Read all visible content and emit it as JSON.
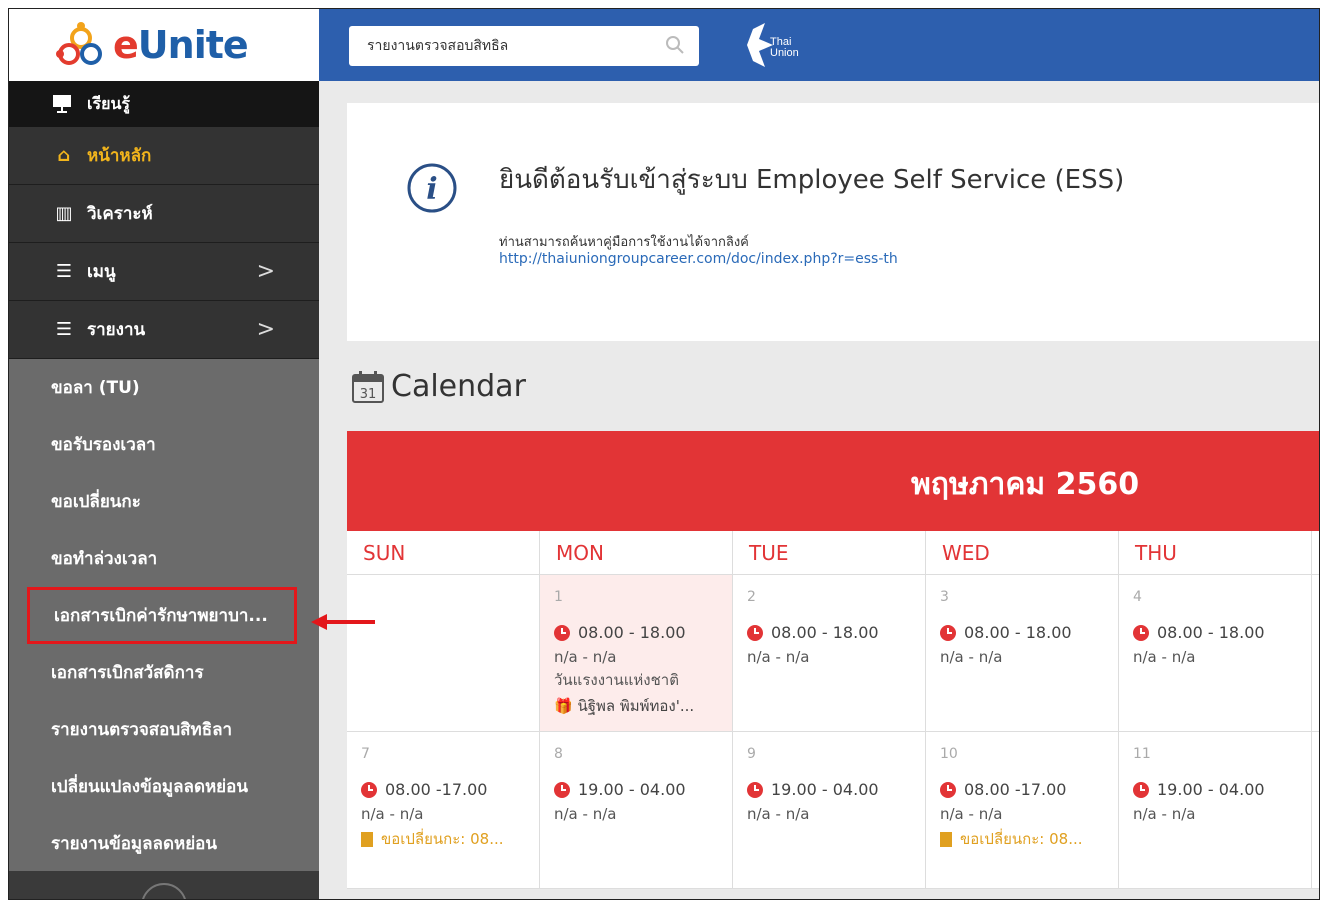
{
  "brand": {
    "logo_text_e": "e",
    "logo_text_rest": "Unite"
  },
  "sidebar": {
    "learn_label": "เรียนรู้",
    "main_items": [
      {
        "label": "หน้าหลัก",
        "icon": "home-icon"
      },
      {
        "label": "วิเคราะห์",
        "icon": "analytics-icon"
      },
      {
        "label": "เมนู",
        "icon": "list-icon",
        "chevron": ">"
      },
      {
        "label": "รายงาน",
        "icon": "list-icon",
        "chevron": ">"
      }
    ],
    "sub_items": [
      "ขอลา (TU)",
      "ขอรับรองเวลา",
      "ขอเปลี่ยนกะ",
      "ขอทำล่วงเวลา",
      "เอกสารเบิกค่ารักษาพยาบา...",
      "เอกสารเบิกสวัสดิการ",
      "รายงานตรวจสอบสิทธิลา",
      "เปลี่ยนแปลงข้อมูลลดหย่อน",
      "รายงานข้อมูลลดหย่อน"
    ]
  },
  "topbar": {
    "search_value": "รายงานตรวจสอบสิทธิล",
    "partner_logo_line1": "Thai",
    "partner_logo_line2": "Union"
  },
  "welcome": {
    "title": "ยินดีต้อนรับเข้าสู่ระบบ Employee Self Service (ESS)",
    "desc": "ท่านสามารถค้นหาคู่มือการใช้งานได้จากลิงค์",
    "link": "http://thaiuniongroupcareer.com/doc/index.php?r=ess-th"
  },
  "calendar": {
    "heading": "Calendar",
    "icon_day": "31",
    "month_label": "พฤษภาคม 2560",
    "weekdays": [
      "SUN",
      "MON",
      "TUE",
      "WED",
      "THU"
    ],
    "rows": [
      [
        {
          "day": "",
          "time": "",
          "na": ""
        },
        {
          "day": "1",
          "time": "08.00 - 18.00",
          "na": "n/a - n/a",
          "holiday": "วันแรงงานแห่งชาติ",
          "person": "นิฐิพล พิมพ์ทอง'..."
        },
        {
          "day": "2",
          "time": "08.00 - 18.00",
          "na": "n/a - n/a"
        },
        {
          "day": "3",
          "time": "08.00 - 18.00",
          "na": "n/a - n/a"
        },
        {
          "day": "4",
          "time": "08.00 - 18.00",
          "na": "n/a - n/a"
        }
      ],
      [
        {
          "day": "7",
          "time": "08.00 -17.00",
          "na": "n/a - n/a",
          "shift": "ขอเปลี่ยนกะ: 08..."
        },
        {
          "day": "8",
          "time": "19.00 - 04.00",
          "na": "n/a - n/a"
        },
        {
          "day": "9",
          "time": "19.00 - 04.00",
          "na": "n/a - n/a"
        },
        {
          "day": "10",
          "time": "08.00 -17.00",
          "na": "n/a - n/a",
          "shift": "ขอเปลี่ยนกะ: 08..."
        },
        {
          "day": "11",
          "time": "19.00 - 04.00",
          "na": "n/a - n/a"
        }
      ]
    ]
  },
  "colors": {
    "sidebar_bg": "#6b6b6b",
    "topbar_bg": "#2d5fae",
    "accent_red": "#e23436",
    "active_item": "#f2b51c",
    "highlight_box": "#e3171b"
  }
}
